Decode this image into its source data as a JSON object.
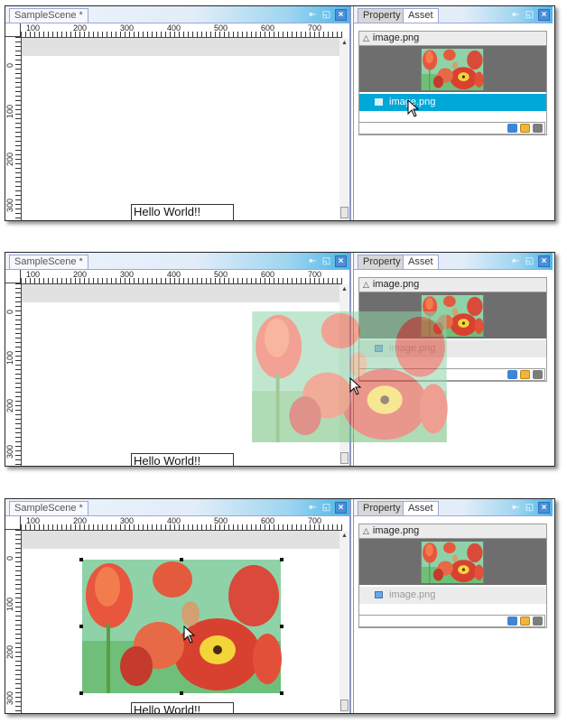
{
  "scene": {
    "tab_label": "SampleScene *",
    "ruler_x_labels": [
      "100",
      "200",
      "300",
      "400",
      "500",
      "600",
      "700"
    ],
    "ruler_y_labels": [
      "0",
      "100",
      "200",
      "300"
    ],
    "text_object": "Hello World!!"
  },
  "panel": {
    "tabs": [
      "Property",
      "Asset"
    ],
    "asset_header": "image.png",
    "asset_item": "image.png"
  },
  "pane_buttons": [
    "pin-icon",
    "restore-icon",
    "close-icon"
  ],
  "toolbar_icons": [
    "refresh-icon",
    "new-folder-icon",
    "delete-icon"
  ],
  "steps": [
    {
      "asset_item_state": "selected",
      "drag_preview": false,
      "image_in_scene": false
    },
    {
      "asset_item_state": "dragging",
      "drag_preview": true,
      "image_in_scene": false
    },
    {
      "asset_item_state": "deselected",
      "drag_preview": false,
      "image_in_scene": true
    }
  ],
  "colors": {
    "selection": "#00a8d8",
    "tabbar_accent": "#4fb6e8",
    "preview_background": "#6e6e6e"
  }
}
